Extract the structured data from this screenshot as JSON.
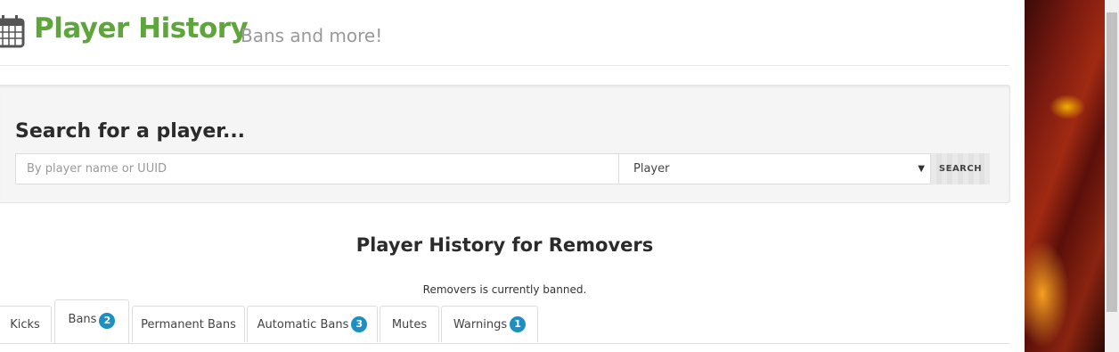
{
  "header": {
    "title": "Player History",
    "subtitle": "Bans and more!"
  },
  "search": {
    "heading": "Search for a player...",
    "placeholder": "By player name or UUID",
    "value": "",
    "type_selected": "Player",
    "button_label": "SEARCH"
  },
  "history": {
    "title": "Player History for Removers",
    "status": "Removers is currently banned."
  },
  "tabs": [
    {
      "label": "Kicks",
      "count": ""
    },
    {
      "label": "Bans",
      "count": "2"
    },
    {
      "label": "Permanent Bans",
      "count": ""
    },
    {
      "label": "Automatic Bans",
      "count": "3"
    },
    {
      "label": "Mutes",
      "count": ""
    },
    {
      "label": "Warnings",
      "count": "1"
    }
  ],
  "active_tab": "Bans",
  "colors": {
    "brand_green": "#5ea63b",
    "badge_blue": "#1d8fc0"
  },
  "icons": {
    "header": "calendar-icon",
    "select": "caret-down-icon"
  }
}
